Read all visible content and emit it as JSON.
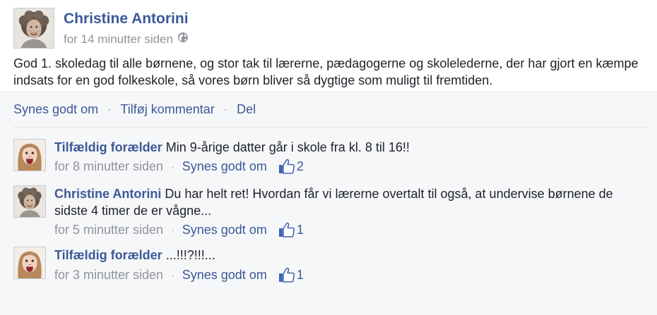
{
  "post": {
    "author": "Christine Antorini",
    "timestamp": "for 14 minutter siden",
    "privacy_icon": "globe-icon",
    "text": "God 1. skoledag til alle børnene, og stor tak til lærerne, pædagogerne og skolelederne, der har gjort en kæmpe indsats for en god folkeskole, så vores børn bliver så dygtige som muligt til fremtiden."
  },
  "actions": {
    "like": "Synes godt om",
    "comment": "Tilføj kommentar",
    "share": "Del",
    "separator": "·"
  },
  "comments": [
    {
      "author": "Tilfældig forælder",
      "text": "Min 9-årige datter går i skole fra kl. 8 til 16!!",
      "timestamp": "for 8 minutter siden",
      "like_label": "Synes godt om",
      "likes": "2"
    },
    {
      "author": "Christine Antorini",
      "text": "Du har helt ret! Hvordan får vi lærerne overtalt til også, at undervise børnene de sidste 4 timer de er vågne...",
      "timestamp": "for 5 minutter siden",
      "like_label": "Synes godt om",
      "likes": "1"
    },
    {
      "author": "Tilfældig forælder",
      "text": "...!!!?!!!...",
      "timestamp": "for 3 minutter siden",
      "like_label": "Synes godt om",
      "likes": "1"
    }
  ],
  "colors": {
    "link": "#3b5998",
    "meta": "#90949c",
    "text": "#1d2129",
    "comment_bg": "#f6f7f9"
  }
}
